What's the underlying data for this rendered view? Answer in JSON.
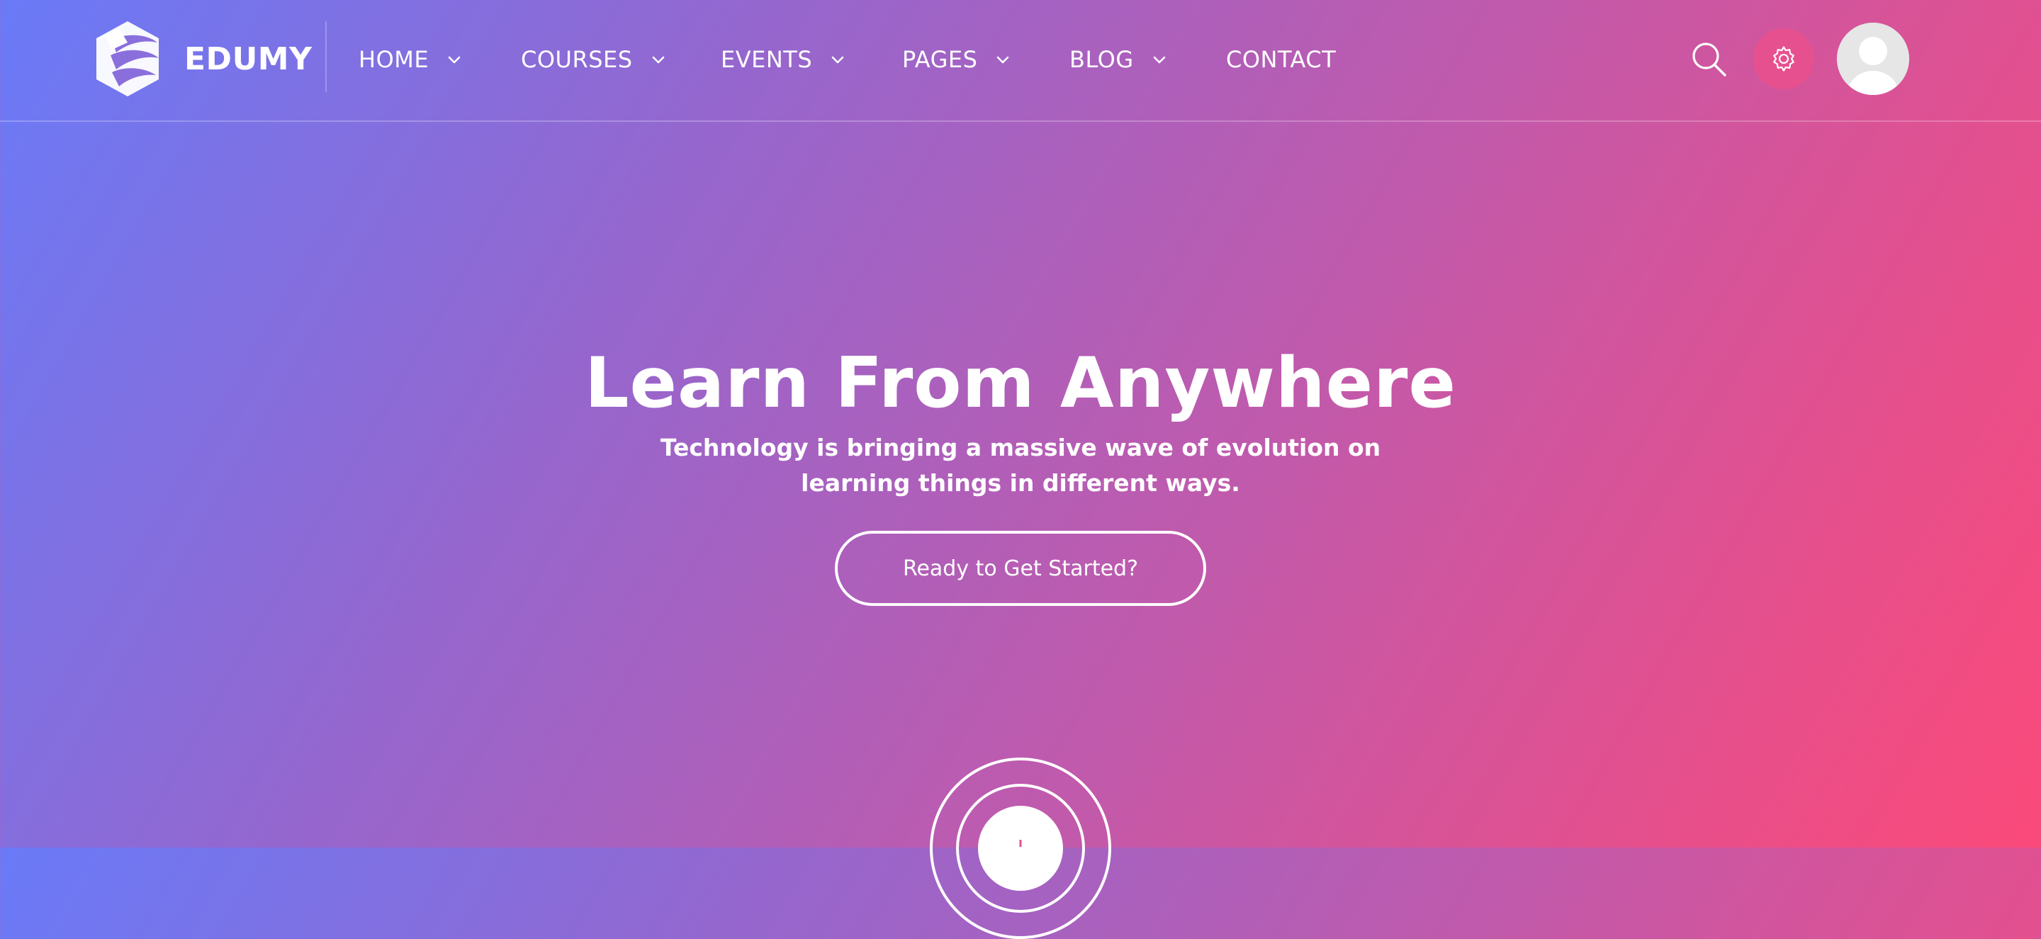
{
  "brand": {
    "name": "EDUMY",
    "logo_icon": "edumy-logo-icon"
  },
  "nav": {
    "items": [
      {
        "label": "HOME",
        "has_dropdown": true
      },
      {
        "label": "COURSES",
        "has_dropdown": true
      },
      {
        "label": "EVENTS",
        "has_dropdown": true
      },
      {
        "label": "PAGES",
        "has_dropdown": true
      },
      {
        "label": "BLOG",
        "has_dropdown": true
      },
      {
        "label": "CONTACT",
        "has_dropdown": false
      }
    ]
  },
  "header_actions": {
    "search_icon": "search-icon",
    "settings_icon": "gear-icon",
    "avatar_icon": "user-avatar-icon"
  },
  "hero": {
    "title": "Learn From Anywhere",
    "subtitle": "Technology is bringing a massive wave of evolution on learning things in different ways.",
    "cta_label": "Ready to Get Started?",
    "play_icon": "play-circle-icon"
  },
  "colors": {
    "gradient_start": "#6a7af7",
    "gradient_end": "#fb4a7a",
    "accent_pink": "#e7508f",
    "text": "#ffffff"
  }
}
